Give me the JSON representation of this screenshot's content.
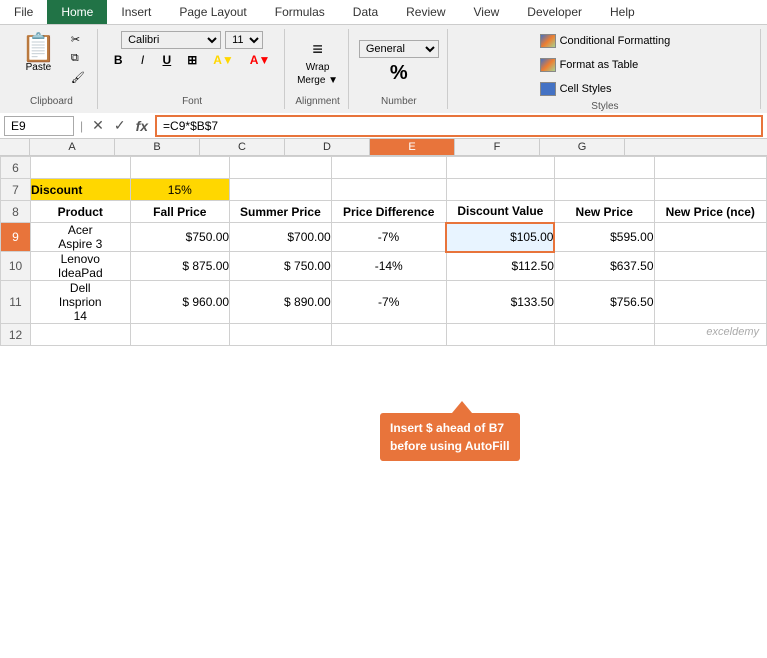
{
  "ribbon": {
    "tabs": [
      "File",
      "Home",
      "Insert",
      "Page Layout",
      "Formulas",
      "Data",
      "Review",
      "View",
      "Developer",
      "Help"
    ],
    "active_tab": "Home",
    "clipboard": {
      "paste_label": "Paste",
      "cut_icon": "✂",
      "copy_icon": "⧉",
      "format_painter_icon": "🖌"
    },
    "font": {
      "face": "Calibri",
      "size": "11",
      "bold": "B",
      "italic": "I",
      "underline": "U"
    },
    "alignment": {
      "label": "Alignment",
      "icon": "≡"
    },
    "number": {
      "label": "Number",
      "icon": "%"
    },
    "styles": {
      "label": "Styles",
      "conditional_formatting": "Conditional Formatting",
      "format_as_table": "Format as Table",
      "cell_styles": "Cell Styles"
    }
  },
  "formula_bar": {
    "cell_ref": "E9",
    "formula": "=C9*$B$7"
  },
  "columns": {
    "headers": [
      "A",
      "B",
      "C",
      "D",
      "E",
      "F",
      "G"
    ],
    "active": "E"
  },
  "rows": {
    "visible": [
      "6",
      "7",
      "8",
      "9",
      "10",
      "11",
      "12"
    ],
    "active": "9"
  },
  "cells": {
    "r7_a": "Discount",
    "r7_b": "15%",
    "r8_a": "Product",
    "r8_b": "Fall Price",
    "r8_c": "Summer Price",
    "r8_d": "Price Difference",
    "r8_e": "Discount Value",
    "r8_f": "New Price",
    "r8_g": "New Price (nce)",
    "r9_a": "Acer\nAspire 3",
    "r9_b": "$750.00",
    "r9_c": "$700.00",
    "r9_d": "-7%",
    "r9_e": "$105.00",
    "r9_f": "$595.00",
    "r10_a": "Lenovo\nIdeaPad",
    "r10_b": "$  875.00",
    "r10_c": "$  750.00",
    "r10_d": "-14%",
    "r10_e": "$112.50",
    "r10_f": "$637.50",
    "r11_a": "Dell\nInsprion\n14",
    "r11_b": "$  960.00",
    "r11_c": "$  890.00",
    "r11_d": "-7%",
    "r11_e": "$133.50",
    "r11_f": "$756.50"
  },
  "tooltip": {
    "text_line1": "Insert $ ahead of B7",
    "text_line2": "before using AutoFill"
  },
  "watermark": "exceldemy"
}
